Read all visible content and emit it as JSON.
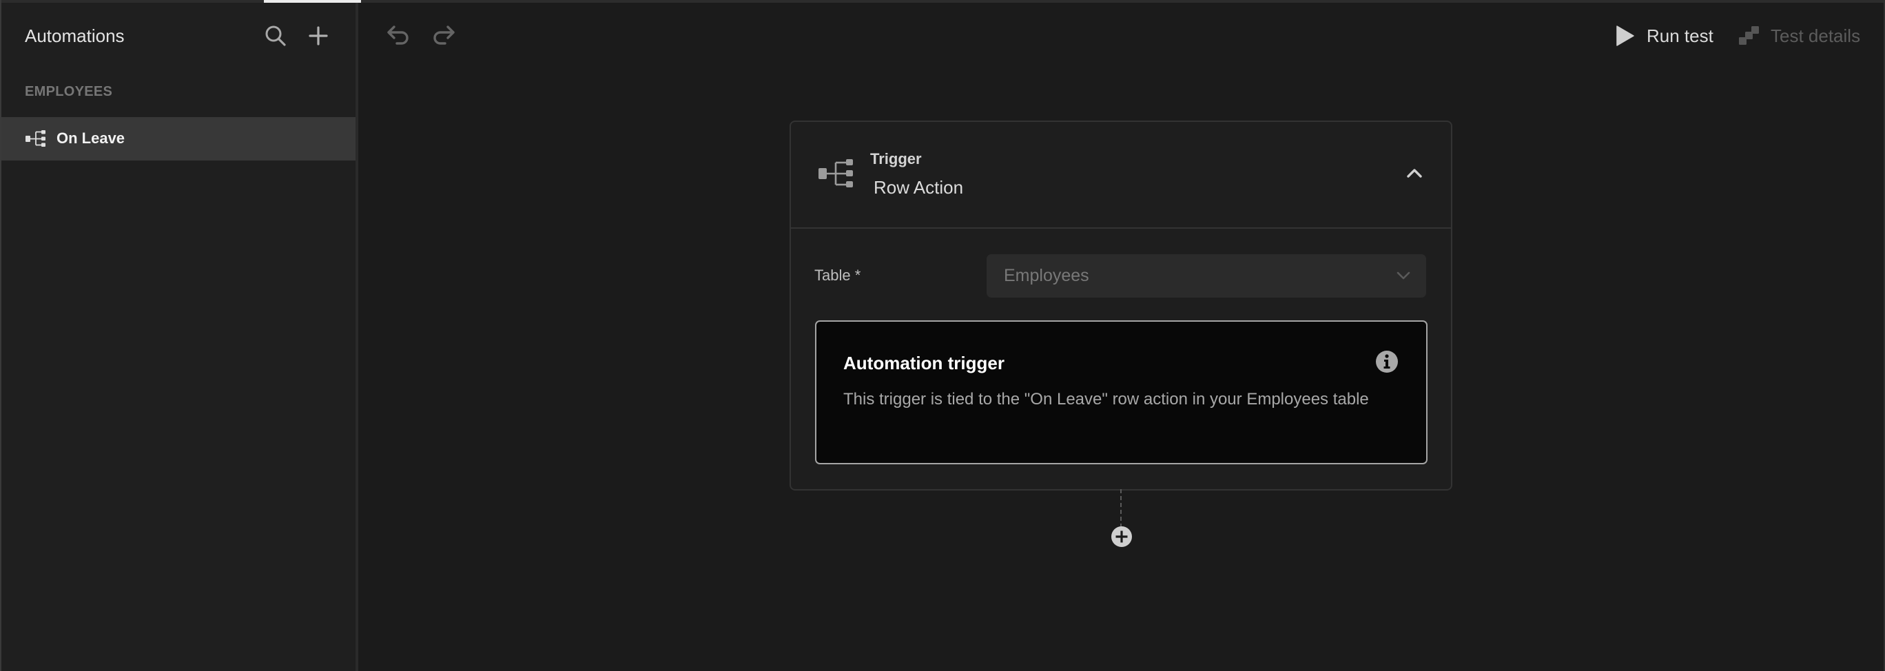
{
  "window": {
    "active_tab_indicator": true
  },
  "sidebar": {
    "title": "Automations",
    "search_icon": "search-icon",
    "add_icon": "plus-icon",
    "groups": [
      {
        "label": "EMPLOYEES",
        "items": [
          {
            "label": "On Leave",
            "icon": "branch-trigger-icon",
            "selected": true
          }
        ]
      }
    ]
  },
  "toolbar": {
    "undo_icon": "undo-icon",
    "redo_icon": "redo-icon",
    "run_test_label": "Run test",
    "run_test_icon": "play-icon",
    "test_details_label": "Test details",
    "test_details_icon": "steps-icon",
    "test_details_enabled": false
  },
  "trigger_card": {
    "type_label": "Trigger",
    "name": "Row Action",
    "icon": "branch-trigger-icon",
    "expanded": true,
    "fields": [
      {
        "label": "Table *",
        "value": "Employees",
        "type": "select",
        "disabled": true
      }
    ],
    "info": {
      "title": "Automation trigger",
      "text": "This trigger is tied to the \"On Leave\" row action in your Employees table",
      "icon": "info-icon"
    }
  },
  "add_step": {
    "icon": "plus-circle-icon"
  },
  "colors": {
    "canvas_bg": "#1b1b1b",
    "sidebar_bg": "#1f1f1f",
    "selected_item_bg": "#383838",
    "card_bg": "#1e1e1e",
    "card_border": "#333333",
    "info_bg": "#080808",
    "info_border": "#a5a5a5",
    "text_primary": "#e4e4e4",
    "text_muted": "#767676",
    "disabled_text": "#5c5c5c"
  }
}
